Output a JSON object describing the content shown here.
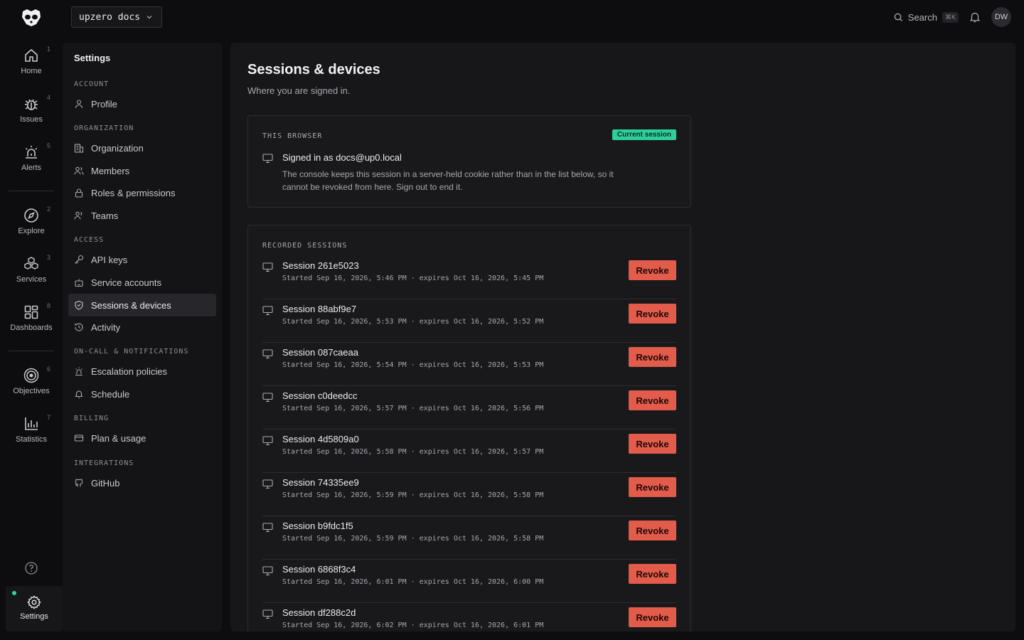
{
  "topbar": {
    "workspace": "upzero docs",
    "search_label": "Search",
    "search_shortcut": "⌘K",
    "avatar_initials": "DW"
  },
  "rail": {
    "items": [
      {
        "label": "Home",
        "num": "1",
        "icon": "home-icon"
      },
      {
        "label": "Issues",
        "num": "4",
        "icon": "bug-icon"
      },
      {
        "label": "Alerts",
        "num": "5",
        "icon": "siren-icon"
      },
      {
        "label": "Explore",
        "num": "2",
        "icon": "compass-icon"
      },
      {
        "label": "Services",
        "num": "3",
        "icon": "cubes-icon"
      },
      {
        "label": "Dashboards",
        "num": "8",
        "icon": "grid-icon"
      },
      {
        "label": "Objectives",
        "num": "6",
        "icon": "target-icon"
      },
      {
        "label": "Statistics",
        "num": "7",
        "icon": "bar-chart-icon"
      }
    ],
    "settings_label": "Settings"
  },
  "settings_nav": {
    "title": "Settings",
    "sections": [
      {
        "label": "ACCOUNT",
        "items": [
          {
            "label": "Profile",
            "icon": "user-icon"
          }
        ]
      },
      {
        "label": "ORGANIZATION",
        "items": [
          {
            "label": "Organization",
            "icon": "building-icon"
          },
          {
            "label": "Members",
            "icon": "users-icon"
          },
          {
            "label": "Roles & permissions",
            "icon": "lock-icon"
          },
          {
            "label": "Teams",
            "icon": "team-icon"
          }
        ]
      },
      {
        "label": "ACCESS",
        "items": [
          {
            "label": "API keys",
            "icon": "key-icon"
          },
          {
            "label": "Service accounts",
            "icon": "bot-icon"
          },
          {
            "label": "Sessions & devices",
            "icon": "shield-icon",
            "active": true
          },
          {
            "label": "Activity",
            "icon": "history-icon"
          }
        ]
      },
      {
        "label": "ON-CALL & NOTIFICATIONS",
        "items": [
          {
            "label": "Escalation policies",
            "icon": "siren-icon"
          },
          {
            "label": "Schedule",
            "icon": "bell-icon"
          }
        ]
      },
      {
        "label": "BILLING",
        "items": [
          {
            "label": "Plan & usage",
            "icon": "card-icon"
          }
        ]
      },
      {
        "label": "INTEGRATIONS",
        "items": [
          {
            "label": "GitHub",
            "icon": "github-icon"
          }
        ]
      }
    ]
  },
  "main": {
    "title": "Sessions & devices",
    "subtitle": "Where you are signed in.",
    "this_browser": {
      "heading": "THIS BROWSER",
      "badge": "Current session",
      "signed_in": "Signed in as docs@up0.local",
      "note": "The console keeps this session in a server-held cookie rather than in the list below, so it cannot be revoked from here. Sign out to end it."
    },
    "recorded": {
      "heading": "RECORDED SESSIONS",
      "revoke_label": "Revoke",
      "sessions": [
        {
          "name": "Session 261e5023",
          "meta": "Started Sep 16, 2026, 5:46 PM · expires Oct 16, 2026, 5:45 PM"
        },
        {
          "name": "Session 88abf9e7",
          "meta": "Started Sep 16, 2026, 5:53 PM · expires Oct 16, 2026, 5:52 PM"
        },
        {
          "name": "Session 087caeaa",
          "meta": "Started Sep 16, 2026, 5:54 PM · expires Oct 16, 2026, 5:53 PM"
        },
        {
          "name": "Session c0deedcc",
          "meta": "Started Sep 16, 2026, 5:57 PM · expires Oct 16, 2026, 5:56 PM"
        },
        {
          "name": "Session 4d5809a0",
          "meta": "Started Sep 16, 2026, 5:58 PM · expires Oct 16, 2026, 5:57 PM"
        },
        {
          "name": "Session 74335ee9",
          "meta": "Started Sep 16, 2026, 5:59 PM · expires Oct 16, 2026, 5:58 PM"
        },
        {
          "name": "Session b9fdc1f5",
          "meta": "Started Sep 16, 2026, 5:59 PM · expires Oct 16, 2026, 5:58 PM"
        },
        {
          "name": "Session 6868f3c4",
          "meta": "Started Sep 16, 2026, 6:01 PM · expires Oct 16, 2026, 6:00 PM"
        },
        {
          "name": "Session df288c2d",
          "meta": "Started Sep 16, 2026, 6:02 PM · expires Oct 16, 2026, 6:01 PM"
        }
      ]
    }
  },
  "colors": {
    "accent_green": "#2fcf9d",
    "revoke_red": "#e25b4b",
    "background": "#0d0d0f"
  }
}
